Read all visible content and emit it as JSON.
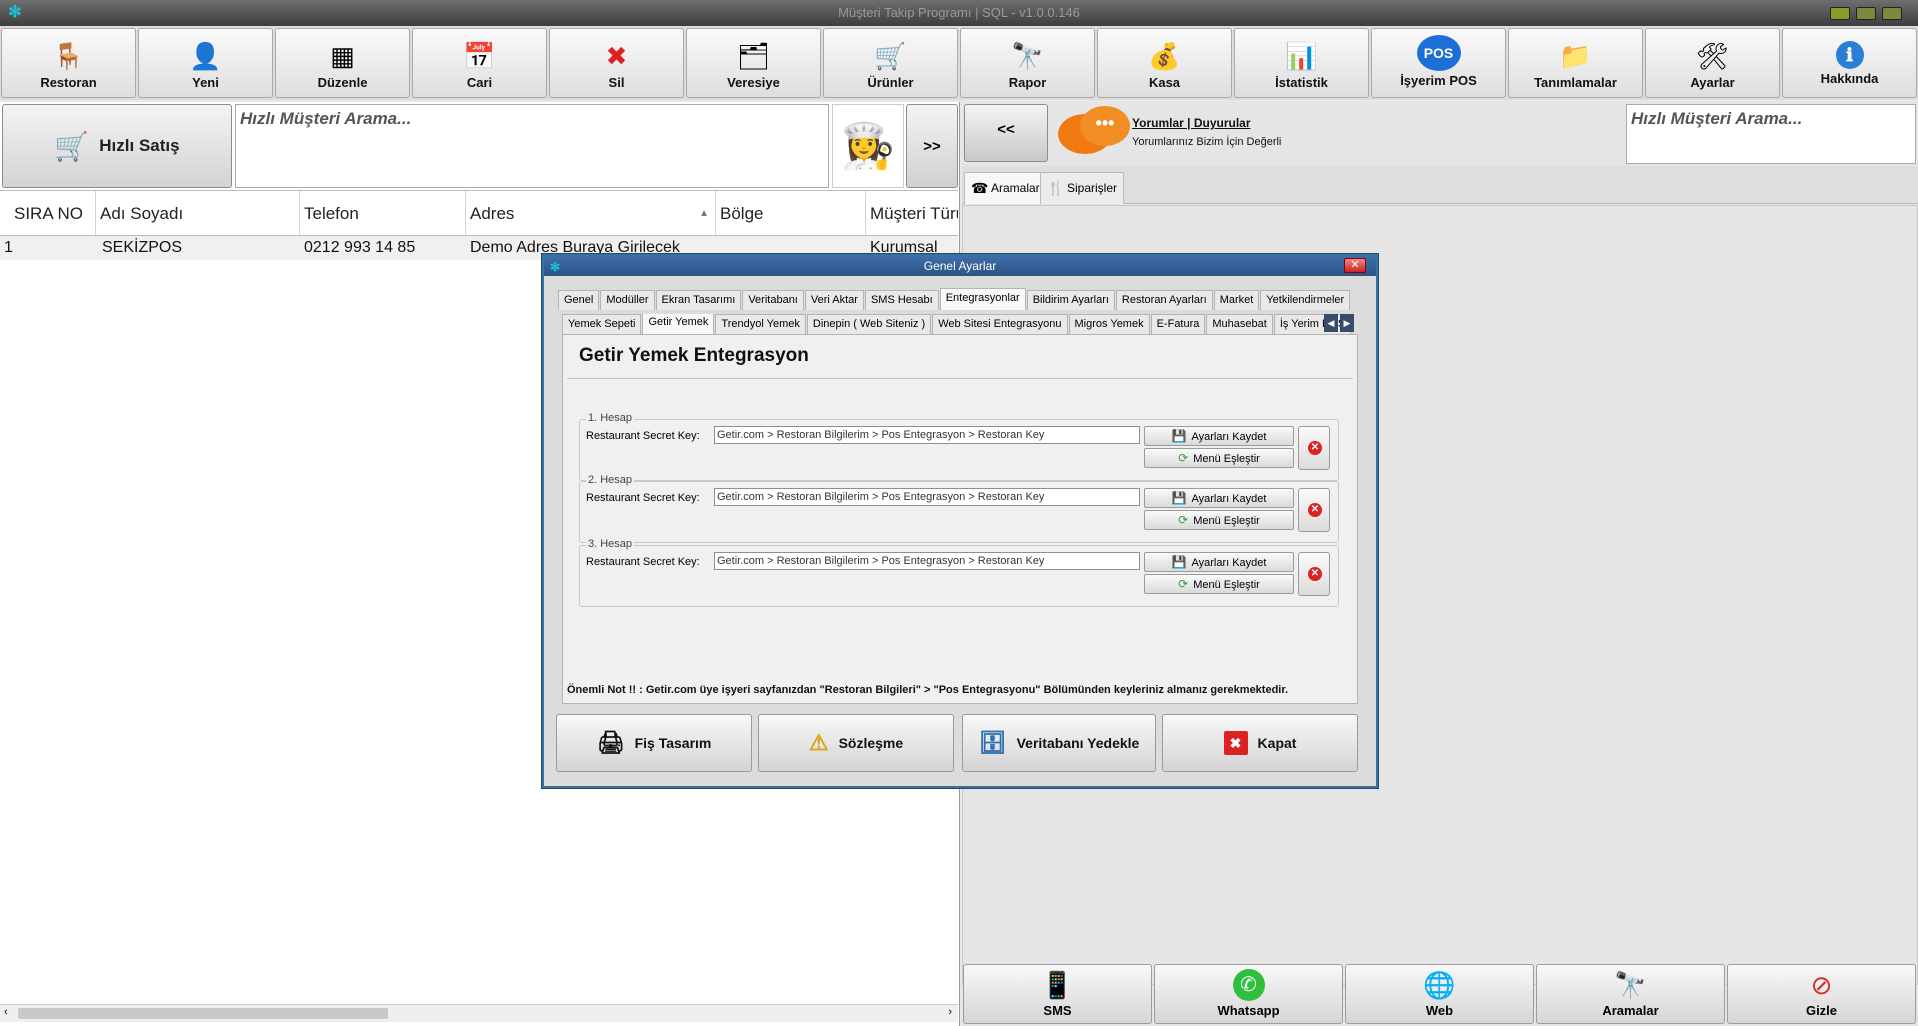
{
  "window": {
    "title": "Müşteri Takip Programı | SQL - v1.0.0.146"
  },
  "toolbar": [
    {
      "label": "Restoran",
      "icon": "table-chairs-icon",
      "glyph": "🪑"
    },
    {
      "label": "Yeni",
      "icon": "person-icon",
      "glyph": "👤"
    },
    {
      "label": "Düzenle",
      "icon": "grid-edit-icon",
      "glyph": "▦"
    },
    {
      "label": "Cari",
      "icon": "calendar-person-icon",
      "glyph": "📅"
    },
    {
      "label": "Sil",
      "icon": "red-x-icon",
      "glyph": "✖"
    },
    {
      "label": "Veresiye",
      "icon": "id-card-icon",
      "glyph": "🗂"
    },
    {
      "label": "Ürünler",
      "icon": "shopping-cart-icon",
      "glyph": "🛒"
    },
    {
      "label": "Rapor",
      "icon": "binoculars-icon",
      "glyph": "🔭"
    },
    {
      "label": "Kasa",
      "icon": "coins-icon",
      "glyph": "💰"
    },
    {
      "label": "İstatistik",
      "icon": "bar-chart-icon",
      "glyph": "📊"
    },
    {
      "label": "İşyerim POS",
      "icon": "pos-icon",
      "glyph": "POS"
    },
    {
      "label": "Tanımlamalar",
      "icon": "folder-gear-icon",
      "glyph": "📁"
    },
    {
      "label": "Ayarlar",
      "icon": "tools-icon",
      "glyph": "🛠"
    },
    {
      "label": "Hakkında",
      "icon": "info-icon",
      "glyph": "ℹ"
    }
  ],
  "left": {
    "quick_sale": "Hızlı Satış",
    "search_placeholder": "Hızlı Müşteri Arama...",
    "next": ">>"
  },
  "grid": {
    "columns": [
      "SIRA NO",
      "Adı Soyadı",
      "Telefon",
      "Adres",
      "Bölge",
      "Müşteri Türü"
    ],
    "rows": [
      [
        "1",
        "SEKİZPOS",
        "0212 993 14 85",
        "Demo Adres Buraya Girilecek",
        "",
        "Kurumsal"
      ]
    ]
  },
  "right": {
    "back": "<<",
    "announce_title": "Yorumlar | Duyurular",
    "announce_sub": "Yorumlarınız Bizim İçin Değerli",
    "search_placeholder": "Hızlı Müşteri Arama...",
    "tabs": [
      "Aramalar",
      "Siparişler"
    ]
  },
  "bottom": [
    {
      "label": "SMS",
      "glyph": "📱"
    },
    {
      "label": "Whatsapp",
      "glyph": "✆"
    },
    {
      "label": "Web",
      "glyph": "🌐"
    },
    {
      "label": "Aramalar",
      "glyph": "🔭"
    },
    {
      "label": "Gizle",
      "glyph": "⊘"
    }
  ],
  "dialog": {
    "title": "Genel Ayarlar",
    "tabs1": [
      "Genel",
      "Modüller",
      "Ekran Tasarımı",
      "Veritabanı",
      "Veri Aktar",
      "SMS Hesabı",
      "Entegrasyonlar",
      "Bildirim Ayarları",
      "Restoran Ayarları",
      "Market",
      "Yetkilendirmeler"
    ],
    "tabs1_active": 6,
    "tabs2": [
      "Yemek Sepeti",
      "Getir Yemek",
      "Trendyol Yemek",
      "Dinepin ( Web Siteniz )",
      "Web Sitesi Entegrasyonu",
      "Migros Yemek",
      "E-Fatura",
      "Muhasebat",
      "İş Yerim POS"
    ],
    "tabs2_active": 1,
    "panel_title": "Getir Yemek Entegrasyon",
    "accounts": [
      {
        "title": "1. Hesap",
        "label": "Restaurant Secret Key:",
        "value": "Getir.com > Restoran Bilgilerim > Pos Entegrasyon > Restoran Key",
        "save": "Ayarları Kaydet",
        "match": "Menü Eşleştir"
      },
      {
        "title": "2. Hesap",
        "label": "Restaurant Secret Key:",
        "value": "Getir.com > Restoran Bilgilerim > Pos Entegrasyon > Restoran Key",
        "save": "Ayarları Kaydet",
        "match": "Menü Eşleştir"
      },
      {
        "title": "3. Hesap",
        "label": "Restaurant Secret Key:",
        "value": "Getir.com > Restoran Bilgilerim > Pos Entegrasyon > Restoran Key",
        "save": "Ayarları Kaydet",
        "match": "Menü Eşleştir"
      }
    ],
    "note": "Önemli Not !! : Getir.com üye işyeri sayfanızdan \"Restoran Bilgileri\" > \"Pos Entegrasyonu\"  Bölümünden keyleriniz almanız gerekmektedir.",
    "buttons": [
      {
        "label": "Fiş Tasarım",
        "glyph": "🖨"
      },
      {
        "label": "Sözleşme",
        "glyph": "⚠"
      },
      {
        "label": "Veritabanı Yedekle",
        "glyph": "🗄"
      },
      {
        "label": "Kapat",
        "glyph": "✖"
      }
    ]
  },
  "colors": {
    "title_bg": "#4a4a4a",
    "dialog_border": "#3a6fa0",
    "accent_orange": "#f07a10",
    "close_red": "#d22222"
  }
}
